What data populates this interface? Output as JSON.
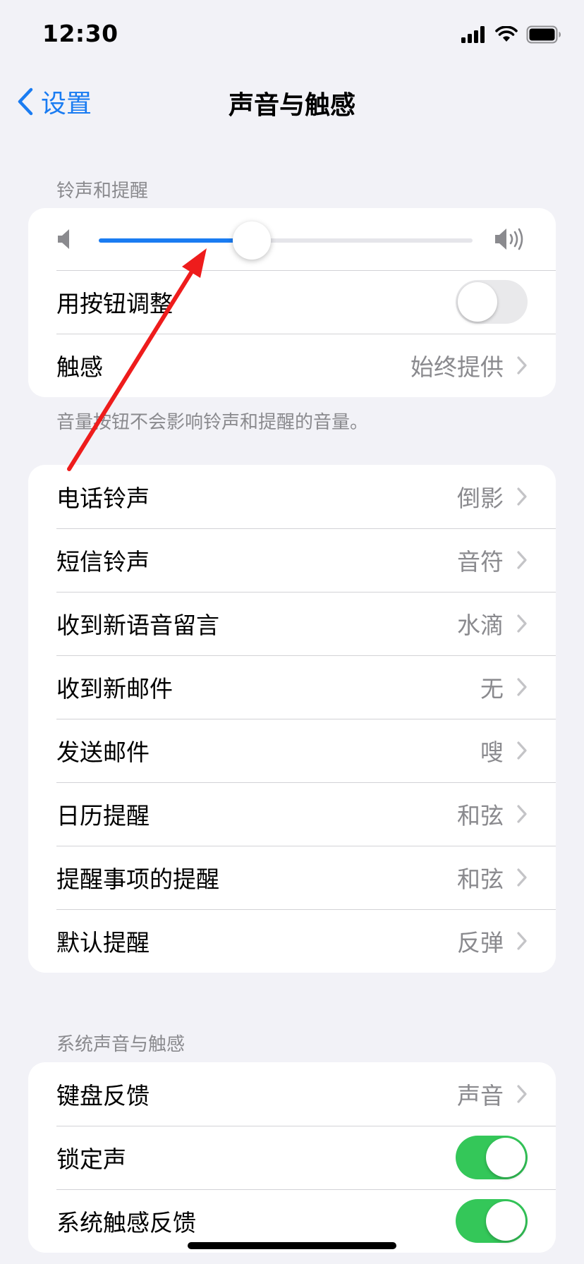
{
  "status": {
    "time": "12:30"
  },
  "nav": {
    "back_label": "设置",
    "title": "声音与触感"
  },
  "ringer_section": {
    "header": "铃声和提醒",
    "volume_level": 0.41,
    "adjust_with_buttons_label": "用按钮调整",
    "adjust_with_buttons_on": false,
    "haptics_label": "触感",
    "haptics_value": "始终提供",
    "footer": "音量按钮不会影响铃声和提醒的音量。"
  },
  "sounds": [
    {
      "label": "电话铃声",
      "value": "倒影"
    },
    {
      "label": "短信铃声",
      "value": "音符"
    },
    {
      "label": "收到新语音留言",
      "value": "水滴"
    },
    {
      "label": "收到新邮件",
      "value": "无"
    },
    {
      "label": "发送邮件",
      "value": "嗖"
    },
    {
      "label": "日历提醒",
      "value": "和弦"
    },
    {
      "label": "提醒事项的提醒",
      "value": "和弦"
    },
    {
      "label": "默认提醒",
      "value": "反弹"
    }
  ],
  "system_section": {
    "header": "系统声音与触感",
    "keyboard_feedback_label": "键盘反馈",
    "keyboard_feedback_value": "声音",
    "lock_sound_label": "锁定声",
    "lock_sound_on": true,
    "system_haptics_label": "系统触感反馈",
    "system_haptics_on": true
  },
  "colors": {
    "accent": "#1a7cf2",
    "toggle_on": "#34c759",
    "annotation_arrow": "#ee1c1c"
  },
  "icons": [
    "chevron-left-icon",
    "chevron-right-icon",
    "speaker-low-icon",
    "speaker-high-icon",
    "cellular-signal-icon",
    "wifi-icon",
    "battery-icon"
  ]
}
